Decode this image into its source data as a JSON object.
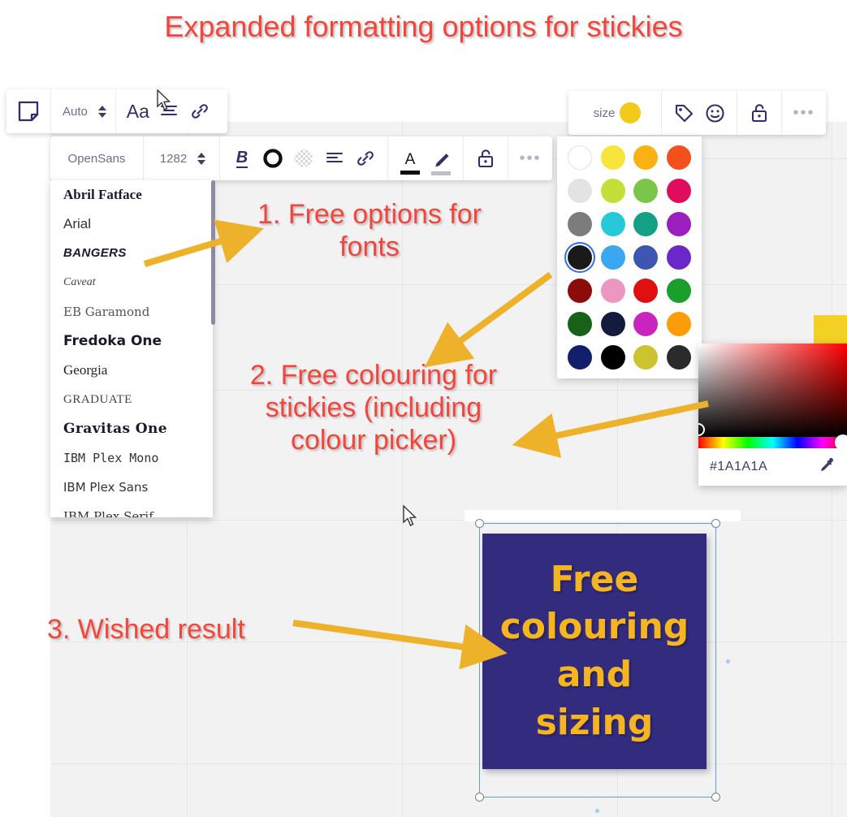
{
  "headline": "Expanded formatting options for stickies",
  "toolbars": {
    "shape_toolbar": {
      "sticky_icon": "sticky-note-icon",
      "size_value": "Auto",
      "font_size_icon": "Aa",
      "align_icon": "align-icon",
      "link_icon": "link-icon"
    },
    "text_toolbar": {
      "font_name": "OpenSans",
      "font_size": "1282",
      "bold_label": "B",
      "outline_icon": "circle-outline-icon",
      "transparency_icon": "checkerboard-transparency-icon",
      "align_icon": "align-left-icon",
      "link_icon": "link-icon",
      "text_color_label": "A",
      "highlighter_icon": "pencil-highlighter-icon",
      "lock_icon": "lock-open-icon",
      "more_icon": "more-options-icon"
    },
    "sticky_toolbar": {
      "size_label": "size",
      "size_swatch_color": "#f2ca1b",
      "tag_icon": "tag-icon",
      "emoji_icon": "emoji-smiley-icon",
      "lock_icon": "lock-open-icon",
      "more_icon": "more-options-icon"
    }
  },
  "font_menu": {
    "items": [
      {
        "label": "Abril Fatface",
        "style": "f-abril"
      },
      {
        "label": "Arial",
        "style": "f-arial"
      },
      {
        "label": "BANGERS",
        "style": "f-bangers"
      },
      {
        "label": "Caveat",
        "style": "f-caveat"
      },
      {
        "label": "EB Garamond",
        "style": "f-garamond"
      },
      {
        "label": "Fredoka One",
        "style": "f-fredoka"
      },
      {
        "label": "Georgia",
        "style": "f-georgia"
      },
      {
        "label": "GRADUATE",
        "style": "f-graduate"
      },
      {
        "label": "Gravitas One",
        "style": "f-gravitas"
      },
      {
        "label": "IBM Plex Mono",
        "style": "f-plexmono"
      },
      {
        "label": "IBM Plex Sans",
        "style": "f-plexsans"
      },
      {
        "label": "IBM Plex Serif",
        "style": "f-plexserif"
      }
    ]
  },
  "palette": {
    "selected_index": 12,
    "swatches": [
      "#ffffff",
      "#f7e53b",
      "#f9b212",
      "#f4501e",
      "#e3e3e3",
      "#c3e03a",
      "#7bc54b",
      "#e00d5f",
      "#7c7c7c",
      "#26c9d8",
      "#14a085",
      "#9b1fbe",
      "#1a1a1a",
      "#3ba7f0",
      "#3d56b2",
      "#6c27c9",
      "#8c0b0b",
      "#ec96c2",
      "#e01010",
      "#1a9e2c",
      "#186118",
      "#141b3d",
      "#c925be",
      "#fc9c06",
      "#12206b",
      "#000000",
      "#cbc42f",
      "#2b2b2b"
    ]
  },
  "color_picker": {
    "hex_value": "#1A1A1A",
    "eyedropper_icon": "eyedropper-icon",
    "hue": "red"
  },
  "result_sticky": {
    "text": "Free colouring and sizing",
    "background_color": "#332b7d",
    "text_color": "#f5b521"
  },
  "annotations": {
    "one": "1. Free options for fonts",
    "two": "2. Free colouring for stickies (including colour picker)",
    "three": "3. Wished result"
  },
  "mini_sticky": {
    "color": "#f2d024"
  }
}
